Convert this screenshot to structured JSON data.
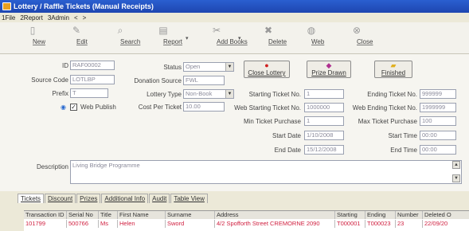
{
  "window": {
    "title": "Lottery / Raffle Tickets (Manual Receipts)"
  },
  "menu": {
    "items": [
      "1File",
      "2Report",
      "3Admin",
      "<",
      ">"
    ]
  },
  "toolbar": {
    "buttons": [
      {
        "label": "New",
        "icon": "document-icon"
      },
      {
        "label": "Edit",
        "icon": "edit-icon"
      },
      {
        "label": "Search",
        "icon": "binoculars-icon"
      },
      {
        "label": "Report",
        "icon": "report-icon"
      },
      {
        "label": "Add Books",
        "icon": "tools-icon"
      },
      {
        "label": "Delete",
        "icon": "delete-icon"
      },
      {
        "label": "Web",
        "icon": "globe-icon"
      },
      {
        "label": "Close",
        "icon": "close-icon"
      }
    ]
  },
  "form": {
    "id_label": "ID",
    "id_value": "RAF00002",
    "source_code_label": "Source Code",
    "source_code_value": "LOTLBP",
    "prefix_label": "Prefix",
    "prefix_value": "T",
    "web_publish_label": "Web Publish",
    "status_label": "Status",
    "status_value": "Open",
    "donation_source_label": "Donation Source",
    "donation_source_value": "FWL",
    "lottery_type_label": "Lottery Type",
    "lottery_type_value": "Non-Book",
    "cost_per_ticket_label": "Cost Per Ticket",
    "cost_per_ticket_value": "10.00",
    "close_lottery_label": "Close Lottery",
    "prize_drawn_label": "Prize Drawn",
    "finished_label": "Finished",
    "starting_ticket_label": "Starting Ticket No.",
    "starting_ticket_value": "1",
    "web_starting_ticket_label": "Web Starting Ticket No.",
    "web_starting_ticket_value": "1000000",
    "min_ticket_purchase_label": "Min Ticket Purchase",
    "min_ticket_purchase_value": "1",
    "start_date_label": "Start Date",
    "start_date_value": "1/10/2008",
    "end_date_label": "End Date",
    "end_date_value": "15/12/2008",
    "ending_ticket_label": "Ending Ticket No.",
    "ending_ticket_value": "999999",
    "web_ending_ticket_label": "Web Ending Ticket No.",
    "web_ending_ticket_value": "1999999",
    "max_ticket_purchase_label": "Max Ticket Purchase",
    "max_ticket_purchase_value": "100",
    "start_time_label": "Start Time",
    "start_time_value": "00:00",
    "end_time_label": "End Time",
    "end_time_value": "00:00",
    "description_label": "Description",
    "description_value": "Living Bridge Programme"
  },
  "tabs": [
    {
      "label": "Tickets"
    },
    {
      "label": "Discount"
    },
    {
      "label": "Prizes"
    },
    {
      "label": "Additional Info"
    },
    {
      "label": "Audit"
    },
    {
      "label": "Table View"
    }
  ],
  "grid": {
    "columns": [
      "Transaction ID",
      "Serial No",
      "Title",
      "First Name",
      "Surname",
      "Address",
      "Starting",
      "Ending",
      "Number",
      "Deleted O"
    ],
    "rows": [
      [
        "101799",
        "500766",
        "Ms",
        "Helen",
        "Sword",
        "4/2 Spofforth Street CREMORNE 2090",
        "T000001",
        "T000023",
        "23",
        "22/09/20"
      ]
    ]
  },
  "colors": {
    "titlebar": "#2a5fd0",
    "row_text": "#d02040"
  }
}
